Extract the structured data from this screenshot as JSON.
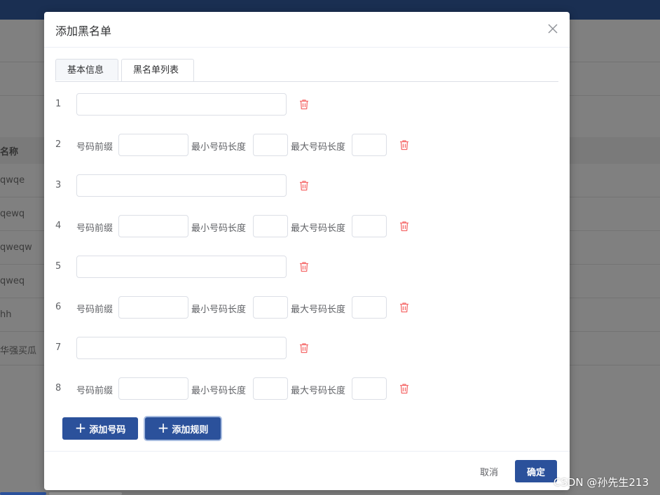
{
  "background": {
    "table_header": "名称",
    "rows": [
      "qwqe",
      "qewq",
      "qweqw",
      "qweq",
      "hh",
      "华强买瓜"
    ]
  },
  "dialog": {
    "title": "添加黑名单",
    "tabs": [
      {
        "label": "基本信息",
        "active": false
      },
      {
        "label": "黑名单列表",
        "active": true
      }
    ],
    "rows": [
      {
        "num": "1",
        "type": "number",
        "value": ""
      },
      {
        "num": "2",
        "type": "rule",
        "prefix_label": "号码前缀",
        "min_label": "最小号码长度",
        "max_label": "最大号码长度",
        "prefix": "",
        "min": "",
        "max": ""
      },
      {
        "num": "3",
        "type": "number",
        "value": ""
      },
      {
        "num": "4",
        "type": "rule",
        "prefix_label": "号码前缀",
        "min_label": "最小号码长度",
        "max_label": "最大号码长度",
        "prefix": "",
        "min": "",
        "max": ""
      },
      {
        "num": "5",
        "type": "number",
        "value": ""
      },
      {
        "num": "6",
        "type": "rule",
        "prefix_label": "号码前缀",
        "min_label": "最小号码长度",
        "max_label": "最大号码长度",
        "prefix": "",
        "min": "",
        "max": ""
      },
      {
        "num": "7",
        "type": "number",
        "value": ""
      },
      {
        "num": "8",
        "type": "rule",
        "prefix_label": "号码前缀",
        "min_label": "最小号码长度",
        "max_label": "最大号码长度",
        "prefix": "",
        "min": "",
        "max": ""
      }
    ],
    "add_number_label": "添加号码",
    "add_rule_label": "添加规则",
    "cancel_label": "取消",
    "confirm_label": "确定"
  },
  "watermark": "CSDN @孙先生213",
  "colors": {
    "primary": "#2b519b",
    "delete": "#f56c6c",
    "topbar": "#1a2f52"
  },
  "icons": {
    "close": "close-icon",
    "delete": "trash-icon",
    "add": "plus-icon"
  }
}
